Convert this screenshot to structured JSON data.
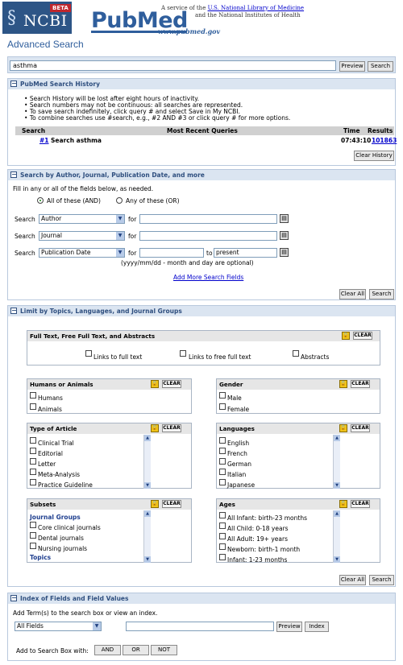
{
  "header": {
    "ncbi": "NCBI",
    "beta": "BETA",
    "pubmed": "PubMed",
    "url": "www.pubmed.gov",
    "service_line1_prefix": "A service of the ",
    "service_line1_link": "U.S. National Library of Medicine",
    "service_line2": "and the National Institutes of Health"
  },
  "page_title": "Advanced Search",
  "search": {
    "value": "asthma",
    "preview": "Preview",
    "search": "Search"
  },
  "history": {
    "title": "PubMed Search History",
    "notes": [
      "Search History will be lost after eight hours of inactivity.",
      "Search numbers may not be continuous: all searches are represented.",
      "To save search indefinitely, click query # and select Save in My NCBI.",
      "To combine searches use #search, e.g., #2 AND #3 or click query # for more options."
    ],
    "cols": {
      "search": "Search",
      "queries": "Most Recent Queries",
      "time": "Time",
      "results": "Results"
    },
    "row": {
      "num": "#1",
      "query": "Search asthma",
      "time": "07:43:10",
      "results": "101863"
    },
    "clear": "Clear History"
  },
  "builder": {
    "title": "Search by Author, Journal, Publication Date, and more",
    "intro": "Fill in any or all of the fields below, as needed.",
    "all": "All of these (AND)",
    "any": "Any of these (OR)",
    "search_label": "Search",
    "for_label": "for",
    "to_label": "to",
    "rows": [
      "Author",
      "Journal",
      "Publication Date"
    ],
    "date_to": "present",
    "date_hint": "(yyyy/mm/dd - month and day are optional)",
    "add_more": "Add More Search Fields",
    "clear_all": "Clear All",
    "search": "Search"
  },
  "limits": {
    "title": "Limit by Topics, Languages, and Journal Groups",
    "clear": "CLEAR",
    "fulltext": {
      "title": "Full Text, Free Full Text, and Abstracts",
      "options": [
        "Links to full text",
        "Links to free full text",
        "Abstracts"
      ]
    },
    "humans": {
      "title": "Humans or Animals",
      "options": [
        "Humans",
        "Animals"
      ]
    },
    "gender": {
      "title": "Gender",
      "options": [
        "Male",
        "Female"
      ]
    },
    "article": {
      "title": "Type of Article",
      "options": [
        "Clinical Trial",
        "Editorial",
        "Letter",
        "Meta-Analysis",
        "Practice Guideline"
      ]
    },
    "languages": {
      "title": "Languages",
      "options": [
        "English",
        "French",
        "German",
        "Italian",
        "Japanese"
      ]
    },
    "subsets": {
      "title": "Subsets",
      "group1": "Journal Groups",
      "options": [
        "Core clinical journals",
        "Dental journals",
        "Nursing journals"
      ],
      "group2": "Topics"
    },
    "ages": {
      "title": "Ages",
      "options": [
        "All Infant: birth-23 months",
        "All Child: 0-18 years",
        "All Adult: 19+ years",
        "Newborn: birth-1 month",
        "Infant: 1-23 months"
      ]
    },
    "clear_all": "Clear All",
    "search": "Search"
  },
  "index": {
    "title": "Index of Fields and Field Values",
    "intro": "Add Term(s) to the search box or view an index.",
    "field": "All Fields",
    "preview": "Preview",
    "index": "Index",
    "add_label": "Add to Search Box with:",
    "and": "AND",
    "or": "OR",
    "not": "NOT"
  }
}
